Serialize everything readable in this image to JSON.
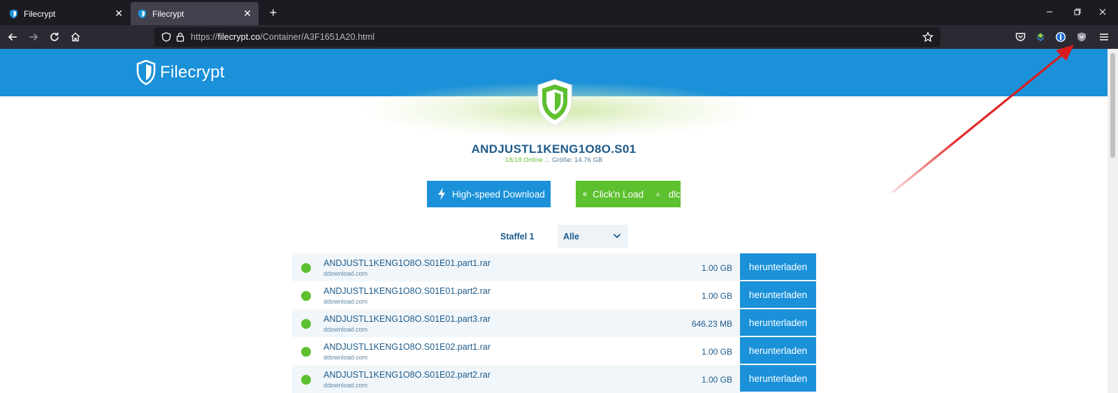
{
  "browser": {
    "tabs": [
      {
        "title": "Filecrypt",
        "active": false
      },
      {
        "title": "Filecrypt",
        "active": true
      }
    ],
    "url_prefix": "https://",
    "url_host": "filecrypt.co",
    "url_path": "/Container/A3F1651A20.html"
  },
  "site": {
    "brand": "Filecrypt"
  },
  "container": {
    "name": "ANDJUSTL1KENG1O8O.S01",
    "online": "18/18 Online",
    "size_text": " .:. Größe: 14.76 GB"
  },
  "actions": {
    "highspeed_label": "High-speed Download",
    "cnl_label": "Click'n Load",
    "dlc_label": "dlc"
  },
  "filter": {
    "label": "Staffel 1",
    "selected": "Alle"
  },
  "files": [
    {
      "name": "ANDJUSTL1KENG1O8O.S01E01.part1.rar",
      "host": "ddownload.com",
      "size": "1.00 GB",
      "action": "herunterladen"
    },
    {
      "name": "ANDJUSTL1KENG1O8O.S01E01.part2.rar",
      "host": "ddownload.com",
      "size": "1.00 GB",
      "action": "herunterladen"
    },
    {
      "name": "ANDJUSTL1KENG1O8O.S01E01.part3.rar",
      "host": "ddownload.com",
      "size": "646.23 MB",
      "action": "herunterladen"
    },
    {
      "name": "ANDJUSTL1KENG1O8O.S01E02.part1.rar",
      "host": "ddownload.com",
      "size": "1.00 GB",
      "action": "herunterladen"
    },
    {
      "name": "ANDJUSTL1KENG1O8O.S01E02.part2.rar",
      "host": "ddownload.com",
      "size": "1.00 GB",
      "action": "herunterladen"
    }
  ],
  "colors": {
    "accent_blue": "#1a91d9",
    "accent_green": "#5dc02f",
    "annotation_arrow": "#e0201f"
  }
}
